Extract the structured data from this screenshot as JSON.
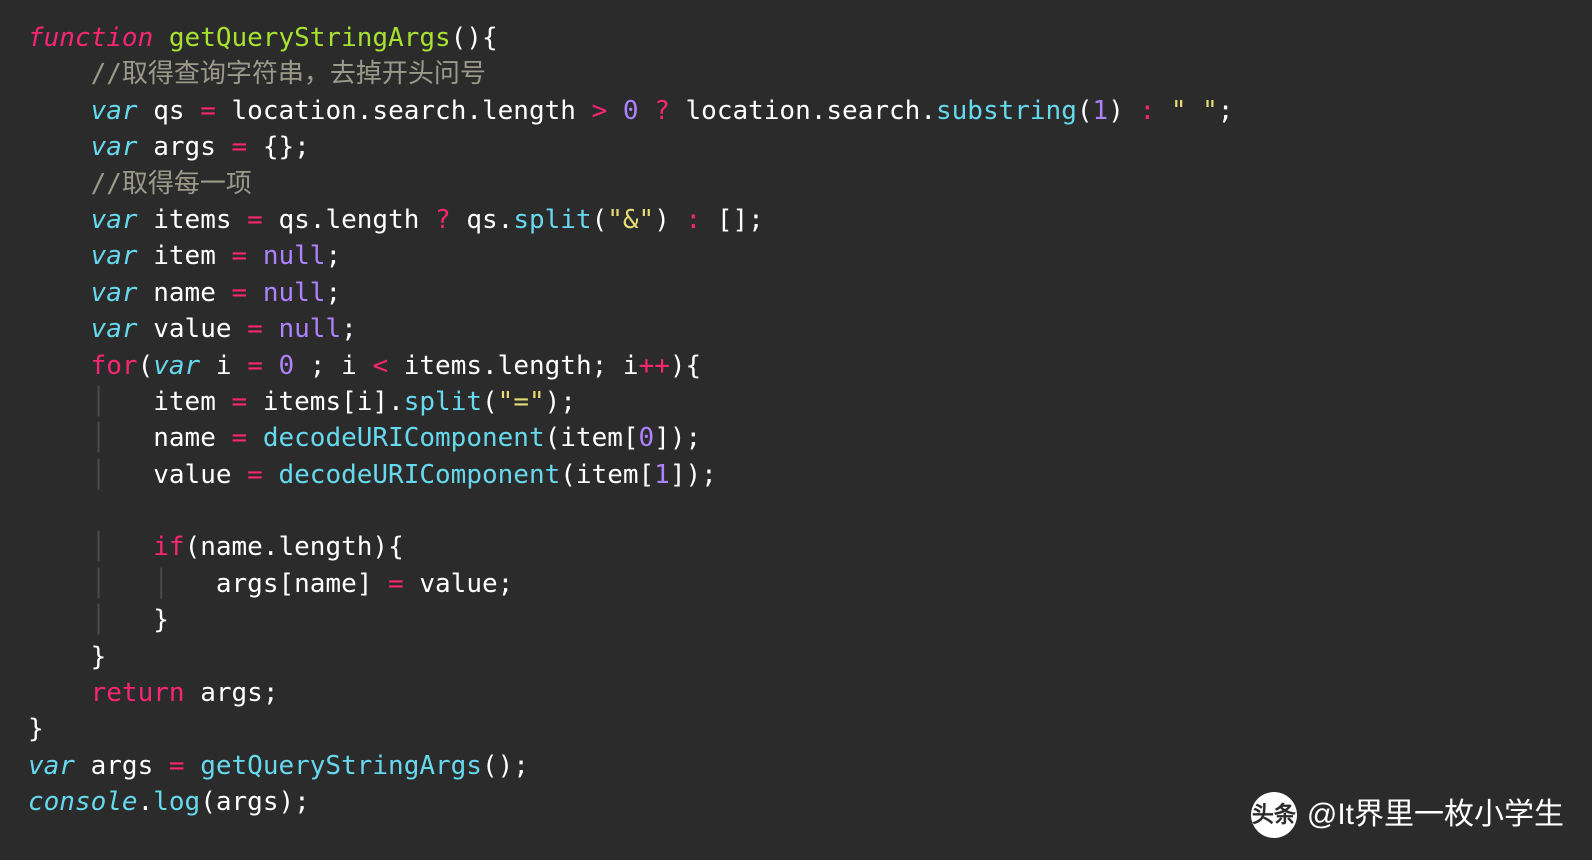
{
  "code": {
    "lines": [
      [
        {
          "t": "function",
          "c": "tok-kw"
        },
        {
          "t": " ",
          "c": ""
        },
        {
          "t": "getQueryStringArgs",
          "c": "tok-fn"
        },
        {
          "t": "(){",
          "c": "tok-punc"
        }
      ],
      [
        {
          "t": "    ",
          "c": ""
        },
        {
          "t": "//取得查询字符串，去掉开头问号",
          "c": "tok-cmt"
        }
      ],
      [
        {
          "t": "    ",
          "c": ""
        },
        {
          "t": "var",
          "c": "tok-var"
        },
        {
          "t": " qs ",
          "c": "tok-id"
        },
        {
          "t": "=",
          "c": "tok-op"
        },
        {
          "t": " location",
          "c": "tok-id"
        },
        {
          "t": ".",
          "c": "tok-punc"
        },
        {
          "t": "search",
          "c": "tok-prop"
        },
        {
          "t": ".",
          "c": "tok-punc"
        },
        {
          "t": "length ",
          "c": "tok-prop"
        },
        {
          "t": ">",
          "c": "tok-op"
        },
        {
          "t": " ",
          "c": ""
        },
        {
          "t": "0",
          "c": "tok-num"
        },
        {
          "t": " ",
          "c": ""
        },
        {
          "t": "?",
          "c": "tok-op"
        },
        {
          "t": " location",
          "c": "tok-id"
        },
        {
          "t": ".",
          "c": "tok-punc"
        },
        {
          "t": "search",
          "c": "tok-prop"
        },
        {
          "t": ".",
          "c": "tok-punc"
        },
        {
          "t": "substring",
          "c": "tok-call"
        },
        {
          "t": "(",
          "c": "tok-punc"
        },
        {
          "t": "1",
          "c": "tok-num"
        },
        {
          "t": ") ",
          "c": "tok-punc"
        },
        {
          "t": ":",
          "c": "tok-op"
        },
        {
          "t": " ",
          "c": ""
        },
        {
          "t": "\" \"",
          "c": "tok-str"
        },
        {
          "t": ";",
          "c": "tok-punc"
        }
      ],
      [
        {
          "t": "    ",
          "c": ""
        },
        {
          "t": "var",
          "c": "tok-var"
        },
        {
          "t": " args ",
          "c": "tok-id"
        },
        {
          "t": "=",
          "c": "tok-op"
        },
        {
          "t": " {};",
          "c": "tok-punc"
        }
      ],
      [
        {
          "t": "    ",
          "c": ""
        },
        {
          "t": "//取得每一项",
          "c": "tok-cmt"
        }
      ],
      [
        {
          "t": "    ",
          "c": ""
        },
        {
          "t": "var",
          "c": "tok-var"
        },
        {
          "t": " items ",
          "c": "tok-id"
        },
        {
          "t": "=",
          "c": "tok-op"
        },
        {
          "t": " qs",
          "c": "tok-id"
        },
        {
          "t": ".",
          "c": "tok-punc"
        },
        {
          "t": "length ",
          "c": "tok-prop"
        },
        {
          "t": "?",
          "c": "tok-op"
        },
        {
          "t": " qs",
          "c": "tok-id"
        },
        {
          "t": ".",
          "c": "tok-punc"
        },
        {
          "t": "split",
          "c": "tok-call"
        },
        {
          "t": "(",
          "c": "tok-punc"
        },
        {
          "t": "\"&\"",
          "c": "tok-str"
        },
        {
          "t": ") ",
          "c": "tok-punc"
        },
        {
          "t": ":",
          "c": "tok-op"
        },
        {
          "t": " [];",
          "c": "tok-punc"
        }
      ],
      [
        {
          "t": "    ",
          "c": ""
        },
        {
          "t": "var",
          "c": "tok-var"
        },
        {
          "t": " item ",
          "c": "tok-id"
        },
        {
          "t": "=",
          "c": "tok-op"
        },
        {
          "t": " ",
          "c": ""
        },
        {
          "t": "null",
          "c": "tok-null"
        },
        {
          "t": ";",
          "c": "tok-punc"
        }
      ],
      [
        {
          "t": "    ",
          "c": ""
        },
        {
          "t": "var",
          "c": "tok-var"
        },
        {
          "t": " name ",
          "c": "tok-id"
        },
        {
          "t": "=",
          "c": "tok-op"
        },
        {
          "t": " ",
          "c": ""
        },
        {
          "t": "null",
          "c": "tok-null"
        },
        {
          "t": ";",
          "c": "tok-punc"
        }
      ],
      [
        {
          "t": "    ",
          "c": ""
        },
        {
          "t": "var",
          "c": "tok-var"
        },
        {
          "t": " value ",
          "c": "tok-id"
        },
        {
          "t": "=",
          "c": "tok-op"
        },
        {
          "t": " ",
          "c": ""
        },
        {
          "t": "null",
          "c": "tok-null"
        },
        {
          "t": ";",
          "c": "tok-punc"
        }
      ],
      [
        {
          "t": "    ",
          "c": ""
        },
        {
          "t": "for",
          "c": "tok-kw-ni"
        },
        {
          "t": "(",
          "c": "tok-punc"
        },
        {
          "t": "var",
          "c": "tok-var"
        },
        {
          "t": " i ",
          "c": "tok-id"
        },
        {
          "t": "=",
          "c": "tok-op"
        },
        {
          "t": " ",
          "c": ""
        },
        {
          "t": "0",
          "c": "tok-num"
        },
        {
          "t": " ; i ",
          "c": "tok-id"
        },
        {
          "t": "<",
          "c": "tok-op"
        },
        {
          "t": " items",
          "c": "tok-id"
        },
        {
          "t": ".",
          "c": "tok-punc"
        },
        {
          "t": "length; i",
          "c": "tok-id"
        },
        {
          "t": "++",
          "c": "tok-op"
        },
        {
          "t": "){",
          "c": "tok-punc"
        }
      ],
      [
        {
          "t": "    ",
          "c": ""
        },
        {
          "t": "│   ",
          "c": "indent-guide"
        },
        {
          "t": "item ",
          "c": "tok-id"
        },
        {
          "t": "=",
          "c": "tok-op"
        },
        {
          "t": " items[i]",
          "c": "tok-id"
        },
        {
          "t": ".",
          "c": "tok-punc"
        },
        {
          "t": "split",
          "c": "tok-call"
        },
        {
          "t": "(",
          "c": "tok-punc"
        },
        {
          "t": "\"=\"",
          "c": "tok-str"
        },
        {
          "t": ");",
          "c": "tok-punc"
        }
      ],
      [
        {
          "t": "    ",
          "c": ""
        },
        {
          "t": "│   ",
          "c": "indent-guide"
        },
        {
          "t": "name ",
          "c": "tok-id"
        },
        {
          "t": "=",
          "c": "tok-op"
        },
        {
          "t": " ",
          "c": ""
        },
        {
          "t": "decodeURIComponent",
          "c": "tok-call"
        },
        {
          "t": "(item[",
          "c": "tok-punc"
        },
        {
          "t": "0",
          "c": "tok-num"
        },
        {
          "t": "]);",
          "c": "tok-punc"
        }
      ],
      [
        {
          "t": "    ",
          "c": ""
        },
        {
          "t": "│   ",
          "c": "indent-guide"
        },
        {
          "t": "value ",
          "c": "tok-id"
        },
        {
          "t": "=",
          "c": "tok-op"
        },
        {
          "t": " ",
          "c": ""
        },
        {
          "t": "decodeURIComponent",
          "c": "tok-call"
        },
        {
          "t": "(item[",
          "c": "tok-punc"
        },
        {
          "t": "1",
          "c": "tok-num"
        },
        {
          "t": "]);",
          "c": "tok-punc"
        }
      ],
      [
        {
          "t": "",
          "c": ""
        }
      ],
      [
        {
          "t": "    ",
          "c": ""
        },
        {
          "t": "│   ",
          "c": "indent-guide"
        },
        {
          "t": "if",
          "c": "tok-kw-ni"
        },
        {
          "t": "(name",
          "c": "tok-id"
        },
        {
          "t": ".",
          "c": "tok-punc"
        },
        {
          "t": "length){",
          "c": "tok-id"
        }
      ],
      [
        {
          "t": "    ",
          "c": ""
        },
        {
          "t": "│   │   ",
          "c": "indent-guide"
        },
        {
          "t": "args[name] ",
          "c": "tok-id"
        },
        {
          "t": "=",
          "c": "tok-op"
        },
        {
          "t": " value;",
          "c": "tok-id"
        }
      ],
      [
        {
          "t": "    ",
          "c": ""
        },
        {
          "t": "│   ",
          "c": "indent-guide"
        },
        {
          "t": "}",
          "c": "tok-punc"
        }
      ],
      [
        {
          "t": "    }",
          "c": "tok-punc"
        }
      ],
      [
        {
          "t": "    ",
          "c": ""
        },
        {
          "t": "return",
          "c": "tok-kw-ni"
        },
        {
          "t": " args;",
          "c": "tok-id"
        }
      ],
      [
        {
          "t": "}",
          "c": "tok-punc"
        }
      ],
      [
        {
          "t": "var",
          "c": "tok-var"
        },
        {
          "t": " args ",
          "c": "tok-id"
        },
        {
          "t": "=",
          "c": "tok-op"
        },
        {
          "t": " ",
          "c": ""
        },
        {
          "t": "getQueryStringArgs",
          "c": "tok-call"
        },
        {
          "t": "();",
          "c": "tok-punc"
        }
      ],
      [
        {
          "t": "console",
          "c": "tok-con"
        },
        {
          "t": ".",
          "c": "tok-punc"
        },
        {
          "t": "log",
          "c": "tok-call"
        },
        {
          "t": "(args);",
          "c": "tok-punc"
        }
      ]
    ]
  },
  "watermark": {
    "logo_text": "头条",
    "handle": "@It界里一枚小学生"
  }
}
